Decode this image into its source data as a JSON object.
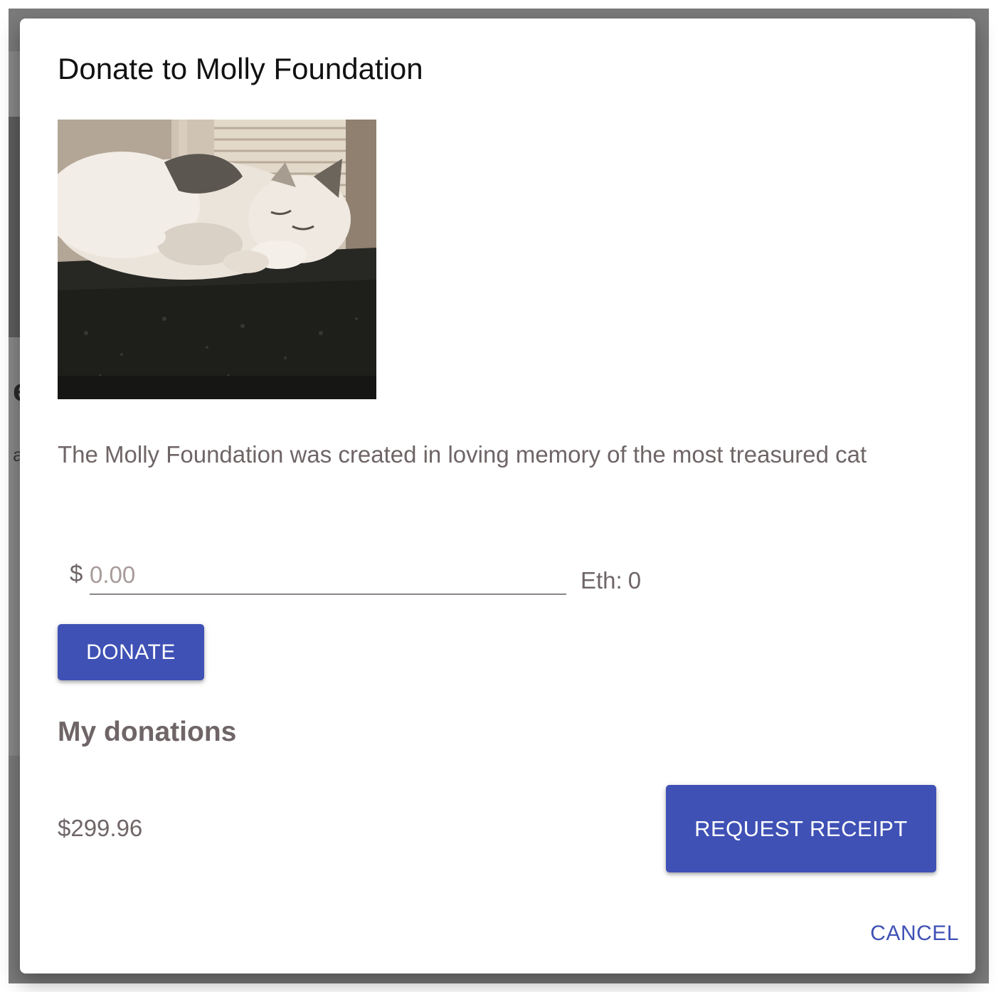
{
  "background_page": {
    "heading_fragment": "es",
    "text_fragment": "a"
  },
  "modal": {
    "title": "Donate to Molly Foundation",
    "image_subject": "sleeping cat on carpeted perch",
    "description": "The Molly Foundation was created in loving memory of the most treasured cat",
    "donation_form": {
      "currency_symbol": "$",
      "amount_value": "",
      "amount_placeholder": "0.00",
      "eth_label": "Eth:",
      "eth_value": "0",
      "donate_label": "DONATE"
    },
    "my_donations": {
      "heading": "My donations",
      "total": "$299.96",
      "request_receipt_label": "REQUEST RECEIPT"
    },
    "cancel_label": "CANCEL"
  },
  "colors": {
    "primary": "#3f51b5",
    "text_secondary": "#6f6566",
    "title": "#111111",
    "backdrop": "#7b7b7b"
  },
  "icons": {}
}
